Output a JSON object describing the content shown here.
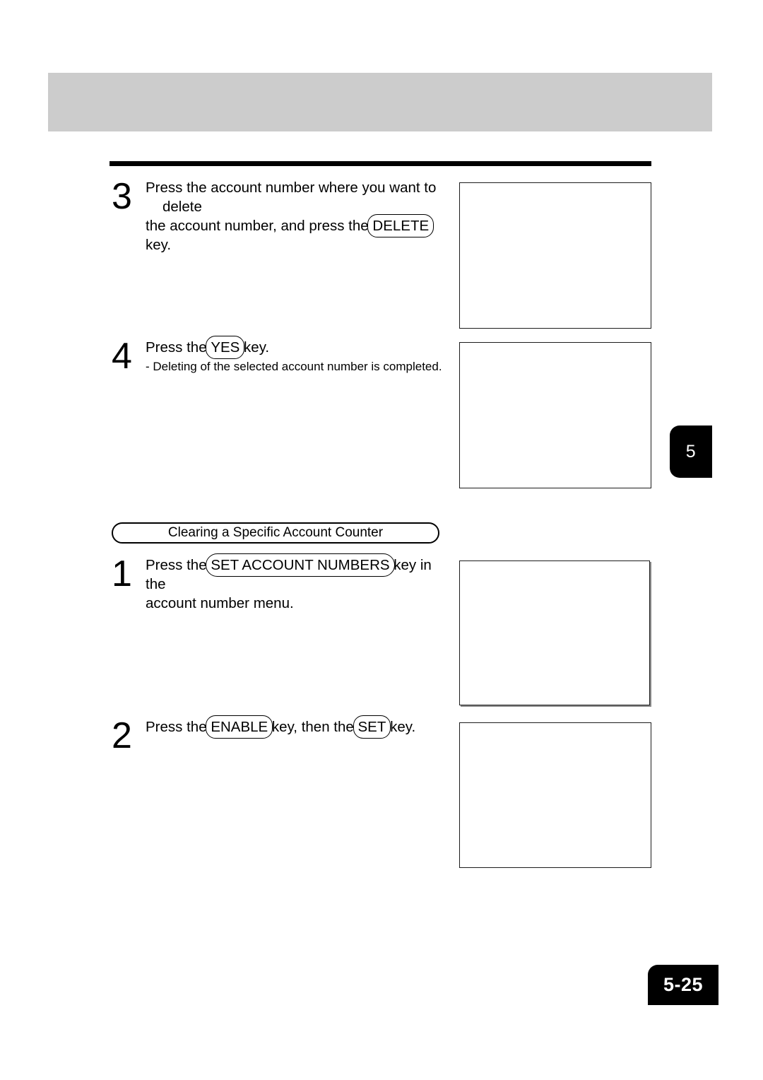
{
  "document": {
    "page_number": "5-25",
    "chapter_tab": "5"
  },
  "steps": [
    {
      "id": "step-3",
      "number": "3",
      "text_before": "Press the account number where you want to",
      "text_gap": "delete",
      "line2_before": "the account number, and press the",
      "key": "DELETE",
      "line2_after": "key."
    },
    {
      "id": "step-4",
      "number": "4",
      "line1_before": "Press the",
      "key": "YES",
      "line1_after": "key.",
      "sub": "- Deleting of the selected account number is completed."
    }
  ],
  "section": {
    "title": "Clearing a Specific Account Counter",
    "steps": [
      {
        "id": "section-step-1",
        "number": "1",
        "line1_before": "Press  the",
        "key": "SET ACCOUNT NUMBERS",
        "line1_after": "key  in  the",
        "line2": "account number menu."
      },
      {
        "id": "section-step-2",
        "number": "2",
        "line1_before": "Press the",
        "key1": "ENABLE",
        "line1_middle": "key, then the",
        "key2": "SET",
        "line1_after": "key."
      }
    ]
  },
  "figures": [
    {
      "id": "figure-step-3",
      "caption": ""
    },
    {
      "id": "figure-step-4",
      "caption": ""
    },
    {
      "id": "figure-section-step-1",
      "caption": ""
    },
    {
      "id": "figure-section-step-2",
      "caption": ""
    }
  ]
}
